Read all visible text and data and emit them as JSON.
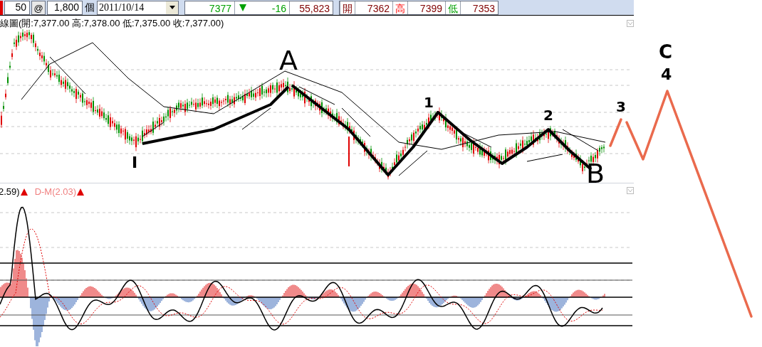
{
  "toolbar": {
    "lot": "50",
    "at": "@",
    "amount": "1,800",
    "unit": "個",
    "date": "2011/10/14"
  },
  "quote": {
    "price": "7377",
    "change": "-16",
    "volume": "55,823",
    "falling": true
  },
  "ohlc": [
    {
      "label": "開",
      "value": "7362",
      "kind": "open"
    },
    {
      "label": "高",
      "value": "7399",
      "kind": "high"
    },
    {
      "label": "低",
      "value": "7353",
      "kind": "low"
    }
  ],
  "main_panel": {
    "title": "線圖(開:7,377.00 高:7,378.00 低:7,375.00 收:7,377.00)"
  },
  "indicator_panel": {
    "label_1": "2.59)",
    "label_2": "D-M(2.03)"
  },
  "annotations": [
    {
      "text": "A"
    },
    {
      "text": "I"
    },
    {
      "text": "1"
    },
    {
      "text": "2"
    },
    {
      "text": "B"
    },
    {
      "text": "3"
    },
    {
      "text": "C"
    },
    {
      "text": "4"
    }
  ]
}
